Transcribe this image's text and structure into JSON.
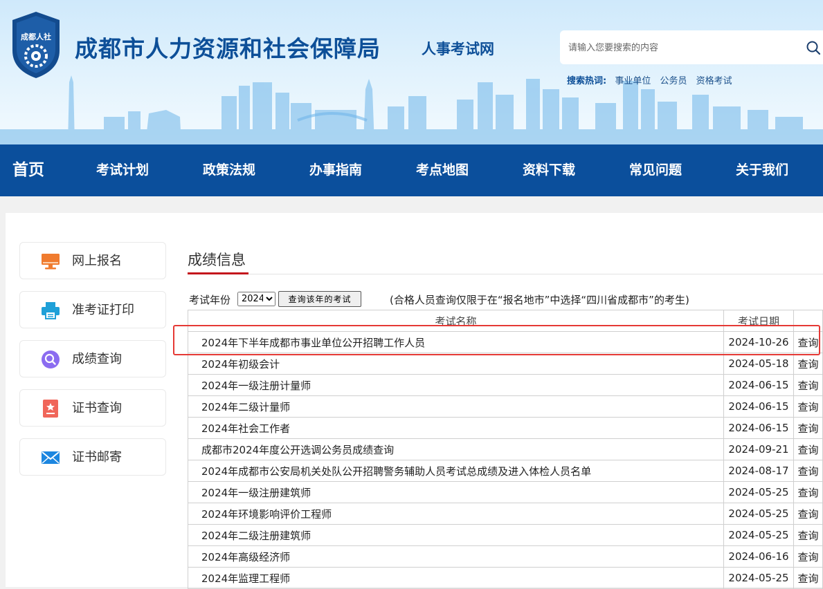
{
  "header": {
    "logo_text": "成都人社",
    "org_title": "成都市人力资源和社会保障局",
    "site_name": "人事考试网",
    "search_placeholder": "请输入您要搜索的内容",
    "hot_label": "搜索热词:",
    "hot_words": [
      "事业单位",
      "公务员",
      "资格考试"
    ],
    "brand_color": "#0b4f9c"
  },
  "nav": {
    "items": [
      "首页",
      "考试计划",
      "政策法规",
      "办事指南",
      "考点地图",
      "资料下载",
      "常见问题",
      "关于我们"
    ]
  },
  "sidebar": {
    "items": [
      {
        "label": "网上报名",
        "icon": "monitor-icon",
        "color": "#f07b2e"
      },
      {
        "label": "准考证打印",
        "icon": "printer-icon",
        "color": "#1fa0d8"
      },
      {
        "label": "成绩查询",
        "icon": "search-icon",
        "color": "#8b6cf0"
      },
      {
        "label": "证书查询",
        "icon": "certificate-icon",
        "color": "#f0665a"
      },
      {
        "label": "证书邮寄",
        "icon": "mail-icon",
        "color": "#1c86e0"
      }
    ]
  },
  "main": {
    "section_title": "成绩信息",
    "filter": {
      "label": "考试年份",
      "year": "2024",
      "button_label": "查询该年的考试",
      "note": "(合格人员查询仅限于在“报名地市”中选择“四川省成都市”的考生)"
    },
    "table": {
      "columns": [
        "考试名称",
        "考试日期",
        ""
      ],
      "action_label": "查询",
      "rows": [
        {
          "name": "2024年下半年成都市事业单位公开招聘工作人员",
          "date": "2024-10-26"
        },
        {
          "name": "2024年初级会计",
          "date": "2024-05-18"
        },
        {
          "name": "2024年一级注册计量师",
          "date": "2024-06-15"
        },
        {
          "name": "2024年二级计量师",
          "date": "2024-06-15"
        },
        {
          "name": "2024年社会工作者",
          "date": "2024-06-15"
        },
        {
          "name": "成都市2024年度公开选调公务员成绩查询",
          "date": "2024-09-21"
        },
        {
          "name": "2024年成都市公安局机关处队公开招聘警务辅助人员考试总成绩及进入体检人员名单",
          "date": "2024-08-17"
        },
        {
          "name": "2024年一级注册建筑师",
          "date": "2024-05-25"
        },
        {
          "name": "2024年环境影响评价工程师",
          "date": "2024-05-25"
        },
        {
          "name": "2024年二级注册建筑师",
          "date": "2024-05-25"
        },
        {
          "name": "2024年高级经济师",
          "date": "2024-06-16"
        },
        {
          "name": "2024年监理工程师",
          "date": "2024-05-25"
        }
      ]
    },
    "highlight_color": "#e53935"
  }
}
